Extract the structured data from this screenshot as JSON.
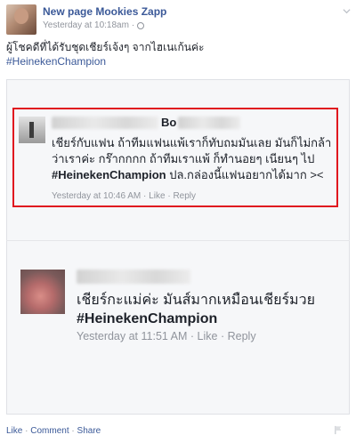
{
  "post": {
    "page_name": "New page Mookies Zapp",
    "timestamp": "Yesterday at 10:18am",
    "timestamp_separator": "·",
    "text": "ผู้โชคดีที่ได้รับชุดเชียร์เจ้งๆ จากไฮเนเก้นค่ะ",
    "hashtag": "#HeinekenChampion"
  },
  "comments": [
    {
      "name_visible": "Bo",
      "text_before": "เชียร์กับแฟน ถ้าทีมแฟนแพ้เราก็ทับถมมันเลย มันก็ไม่กล้าว่าเราค่ะ กร๊ากกกก ถ้าทีมเราแพ้ ก็ทำนอยๆ เนียนๆ ไป ",
      "hashtag": "#HeinekenChampion",
      "text_after": " ปล.กล่องนี้แฟนอยากได้มาก ><",
      "time": "Yesterday at 10:46 AM",
      "like": "Like",
      "reply": "Reply",
      "sep": "·"
    },
    {
      "text_line1": "เชียร์กะแม่ค่ะ มันส์มากเหมือนเชียร์มวย",
      "hashtag": "#HeinekenChampion",
      "time": "Yesterday at 11:51 AM",
      "like": "Like",
      "reply": "Reply",
      "sep": "·"
    }
  ],
  "actions": {
    "like": "Like",
    "comment": "Comment",
    "share": "Share",
    "sep": "·"
  },
  "colors": {
    "link": "#3b5998",
    "muted": "#90949c",
    "highlight_border": "#e0171f"
  },
  "icons": [
    "globe-icon",
    "chevron-down-icon",
    "flag-icon"
  ]
}
